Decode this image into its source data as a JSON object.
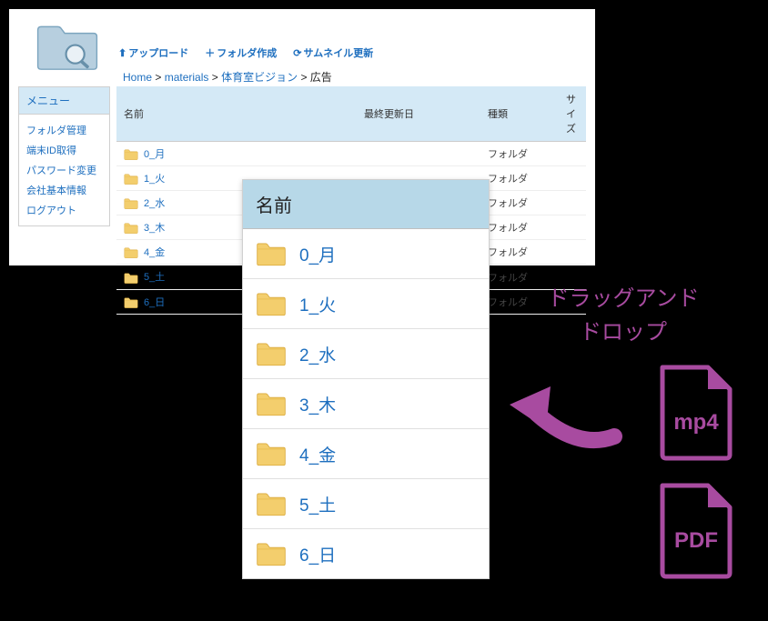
{
  "toolbar": {
    "upload": "アップロード",
    "mkfolder": "フォルダ作成",
    "refresh": "サムネイル更新"
  },
  "breadcrumb": {
    "home": "Home",
    "materials": "materials",
    "taiku": "体育室ビジョン",
    "current": "広告"
  },
  "sidebar": {
    "title": "メニュー",
    "items": [
      "フォルダ管理",
      "端末ID取得",
      "パスワード変更",
      "会社基本情報",
      "ログアウト"
    ]
  },
  "table": {
    "headers": {
      "name": "名前",
      "updated": "最終更新日",
      "type": "種類",
      "size": "サイズ"
    },
    "type_label": "フォルダ",
    "rows": [
      "0_月",
      "1_火",
      "2_水",
      "3_木",
      "4_金",
      "5_土",
      "6_日"
    ]
  },
  "overlay": {
    "header": "名前",
    "rows": [
      "0_月",
      "1_火",
      "2_水",
      "3_木",
      "4_金",
      "5_土",
      "6_日"
    ]
  },
  "annotation": {
    "line1": "ドラッグアンド",
    "line2": "ドロップ"
  },
  "file_types": {
    "mp4": "mp4",
    "pdf": "PDF"
  },
  "colors": {
    "accent": "#1e6fbf",
    "header_bg": "#d4e9f6",
    "overlay_header_bg": "#b7d8e8",
    "purple": "#a84ba0"
  }
}
